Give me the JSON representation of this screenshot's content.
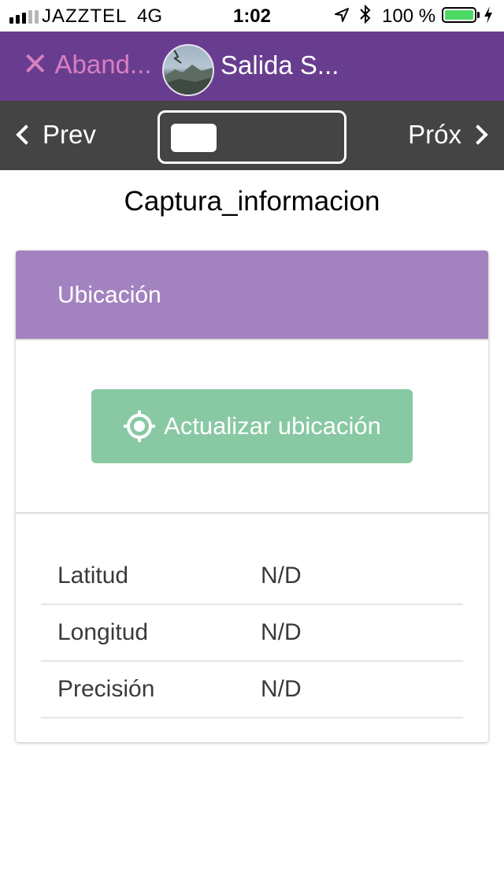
{
  "status_bar": {
    "carrier": "JAZZTEL",
    "network": "4G",
    "time": "1:02",
    "battery": "100 %",
    "battery_color": "#4cd964"
  },
  "app_bar": {
    "abandon_label": "Aband...",
    "title": "Salida S...",
    "close_icon": "close-icon",
    "background": "#683d8f"
  },
  "nav_bar": {
    "prev_label": "Prev",
    "next_label": "Próx",
    "background": "#444444"
  },
  "page": {
    "title": "Captura_informacion"
  },
  "location_card": {
    "header": "Ubicación",
    "header_color": "#a383bf",
    "update_button": "Actualizar ubicación",
    "button_color": "#88c9a3",
    "button_icon": "crosshair-target-icon",
    "rows": [
      {
        "label": "Latitud",
        "value": "N/D"
      },
      {
        "label": "Longitud",
        "value": "N/D"
      },
      {
        "label": "Precisión",
        "value": "N/D"
      }
    ]
  }
}
